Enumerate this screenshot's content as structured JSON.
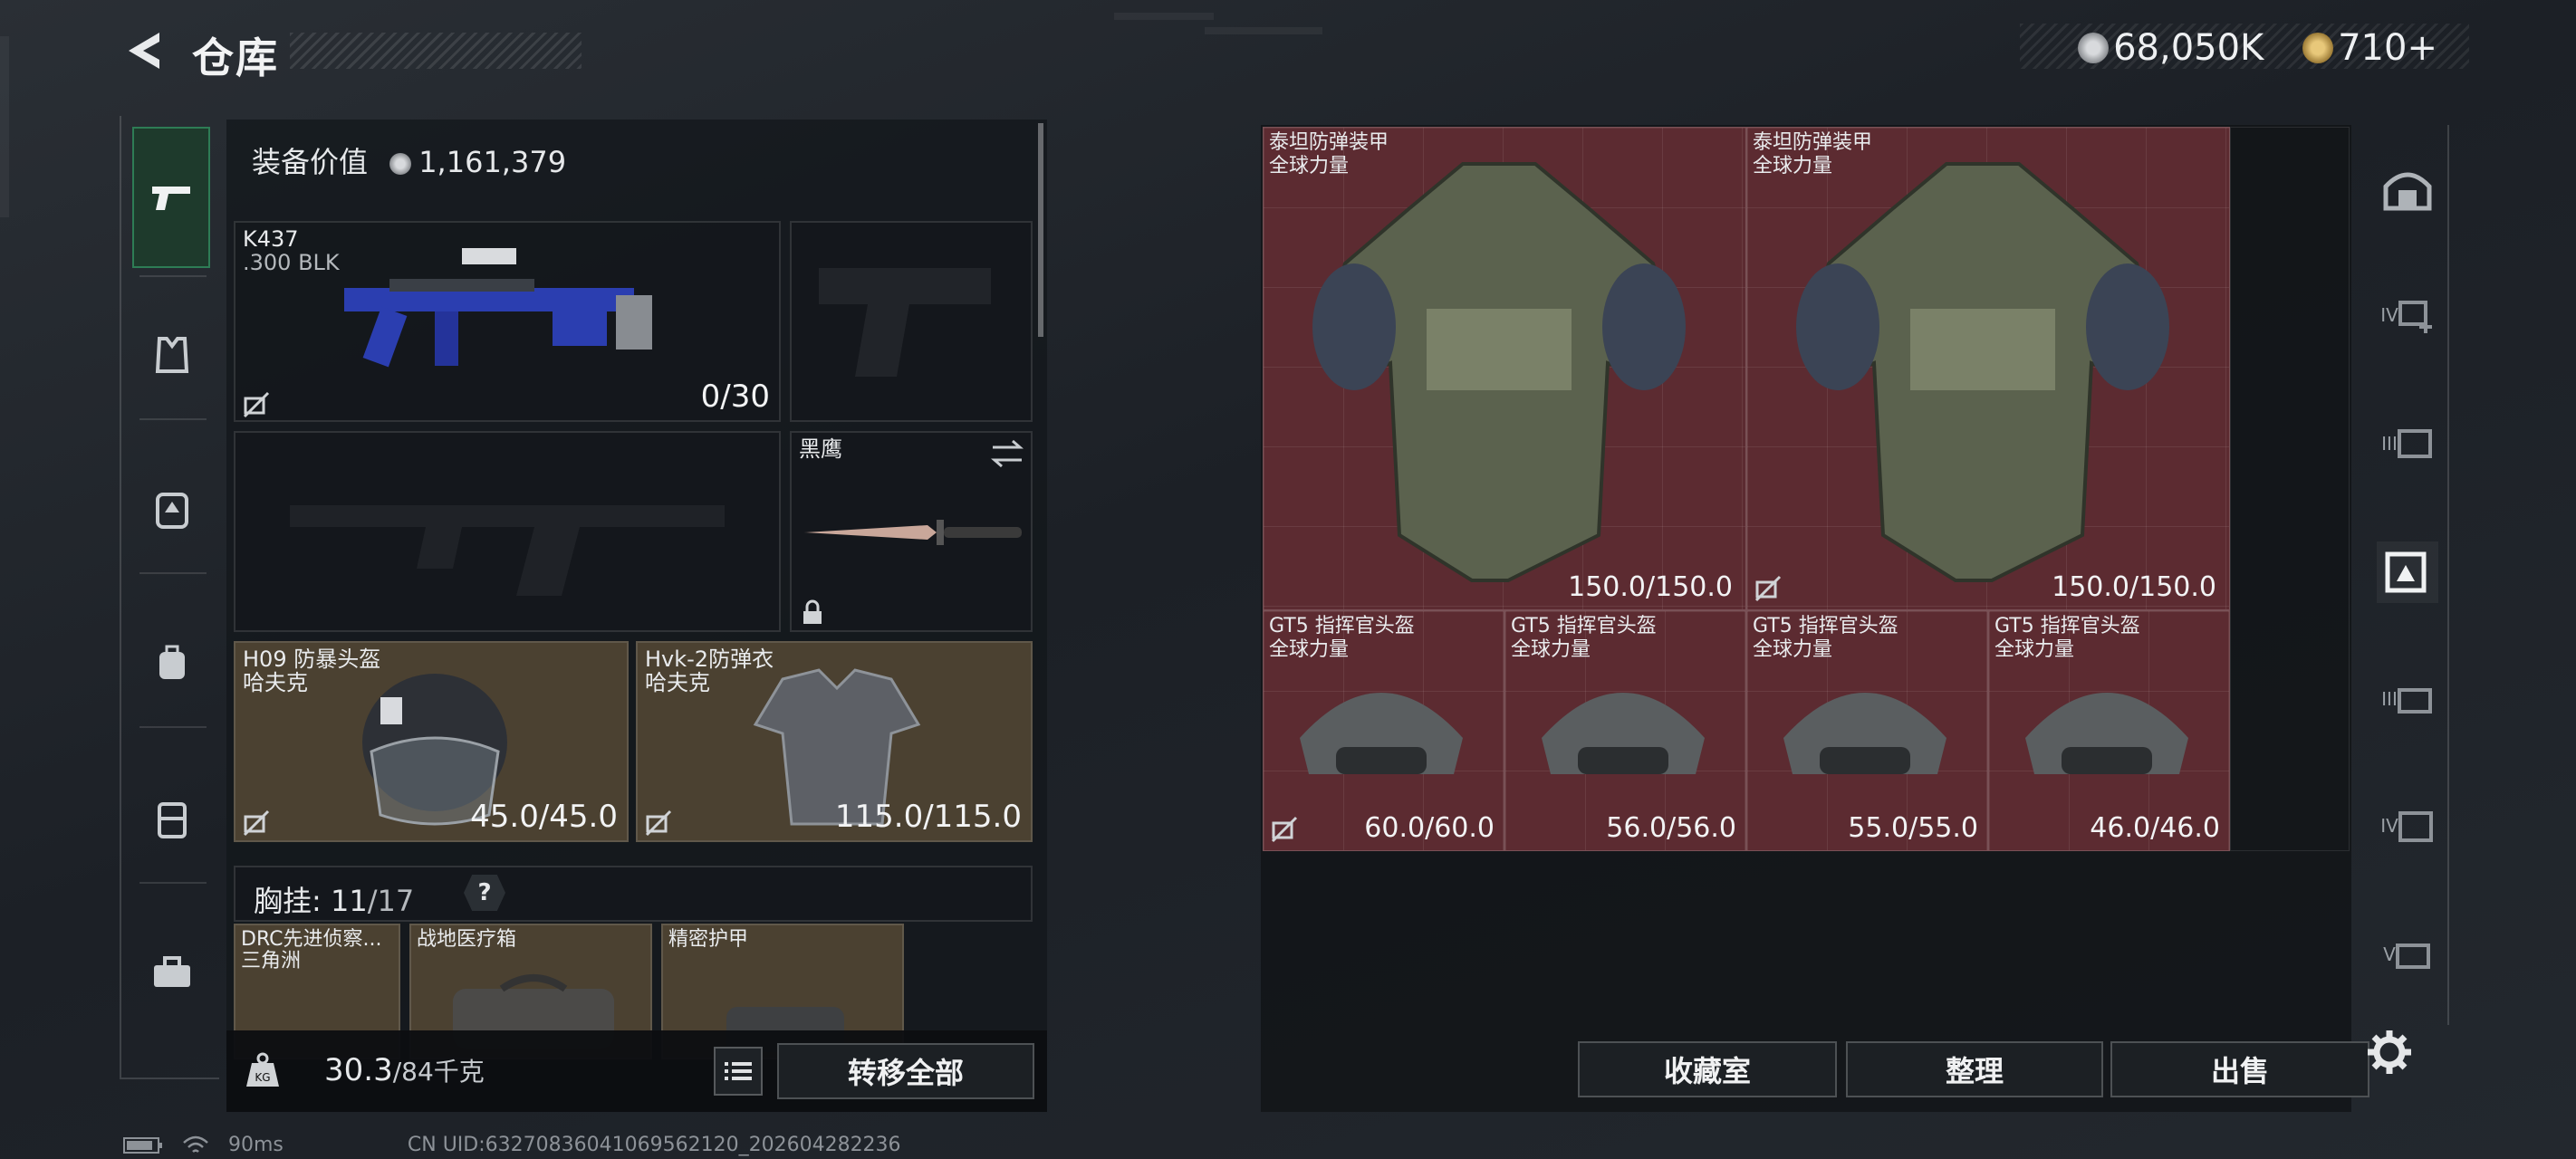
{
  "header": {
    "title": "仓库",
    "coins": "68,050K",
    "tokens": "710",
    "plus": "+"
  },
  "stash": {
    "equipment_value_label": "装备价值",
    "equipment_value": "1,161,379",
    "weapon": {
      "name": "K437",
      "caliber": ".300 BLK",
      "ammo": "0/30"
    },
    "melee": {
      "name": "黑鹰"
    },
    "helmet": {
      "name": "H09 防暴头盔",
      "brand": "哈夫克",
      "durability": "45.0/45.0"
    },
    "armor": {
      "name": "Hvk-2防弹衣",
      "brand": "哈夫克",
      "durability": "115.0/115.0"
    },
    "rig": {
      "label": "胸挂:",
      "used": "11",
      "total": "/17",
      "help": "?"
    },
    "rig_items": [
      {
        "name": "DRC先进侦察...",
        "brand": "三角洲"
      },
      {
        "name": "战地医疗箱",
        "brand": ""
      },
      {
        "name": "精密护甲",
        "brand": ""
      }
    ],
    "weight": {
      "current": "30.3",
      "max": "/84千克"
    },
    "transfer_all": "转移全部"
  },
  "storage": {
    "items": [
      {
        "name": "泰坦防弹装甲",
        "brand": "全球力量",
        "durability": "150.0/150.0"
      },
      {
        "name": "泰坦防弹装甲",
        "brand": "全球力量",
        "durability": "150.0/150.0"
      },
      {
        "name": "GT5 指挥官头盔",
        "brand": "全球力量",
        "durability": "60.0/60.0"
      },
      {
        "name": "GT5 指挥官头盔",
        "brand": "全球力量",
        "durability": "56.0/56.0"
      },
      {
        "name": "GT5 指挥官头盔",
        "brand": "全球力量",
        "durability": "55.0/55.0"
      },
      {
        "name": "GT5 指挥官头盔",
        "brand": "全球力量",
        "durability": "46.0/46.0"
      }
    ],
    "buttons": {
      "collection": "收藏室",
      "organize": "整理",
      "sell": "出售"
    }
  },
  "rightnav": {
    "tiers": [
      "IV",
      "III",
      "III",
      "IV",
      "V"
    ]
  },
  "status": {
    "ping": "90ms",
    "uid": "CN UID:6327083604106956212​0_202604282236"
  },
  "colors": {
    "item_bg": "#5c2b31",
    "equipped_bg": "#4b4131",
    "active_nav": "#2e7c55"
  }
}
